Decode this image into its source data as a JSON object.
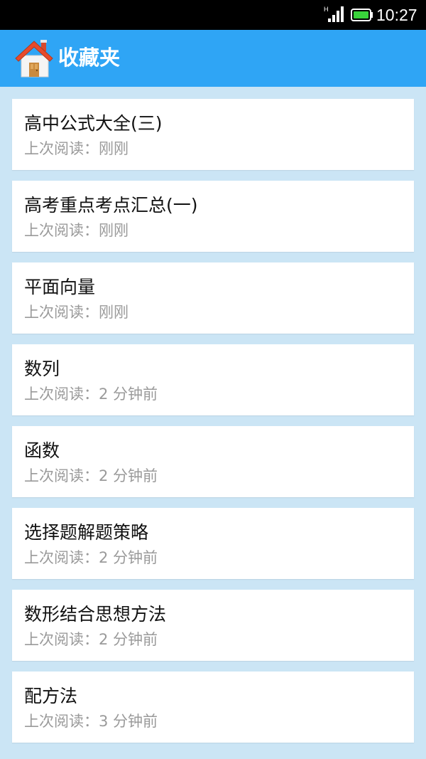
{
  "status_bar": {
    "time": "10:27",
    "network_label": "H",
    "icons": [
      "signal-icon",
      "battery-icon"
    ],
    "battery_color": "#39d23b"
  },
  "header": {
    "title": "收藏夹",
    "icon": "home-icon",
    "bg_color": "#2fa5f5"
  },
  "favorites": [
    {
      "title": "高中公式大全(三)",
      "last_read": "上次阅读：刚刚"
    },
    {
      "title": "高考重点考点汇总(一)",
      "last_read": "上次阅读：刚刚"
    },
    {
      "title": "平面向量",
      "last_read": "上次阅读：刚刚"
    },
    {
      "title": "数列",
      "last_read": "上次阅读：2 分钟前"
    },
    {
      "title": "函数",
      "last_read": "上次阅读：2 分钟前"
    },
    {
      "title": "选择题解题策略",
      "last_read": "上次阅读：2 分钟前"
    },
    {
      "title": "数形结合思想方法",
      "last_read": "上次阅读：2 分钟前"
    },
    {
      "title": "配方法",
      "last_read": "上次阅读：3 分钟前"
    }
  ]
}
